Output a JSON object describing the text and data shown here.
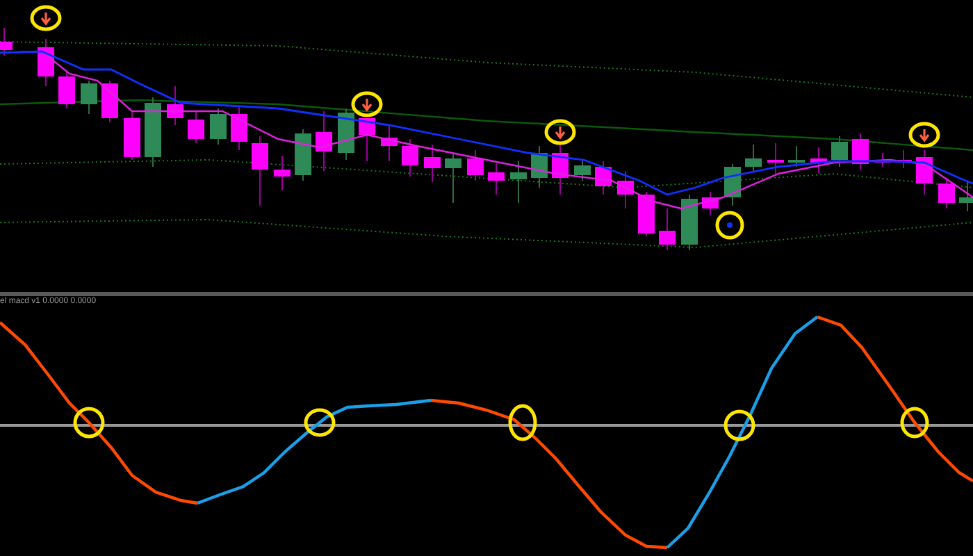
{
  "indicator_pane": {
    "label": "el macd v1 0.0000 0.0000"
  }
}
